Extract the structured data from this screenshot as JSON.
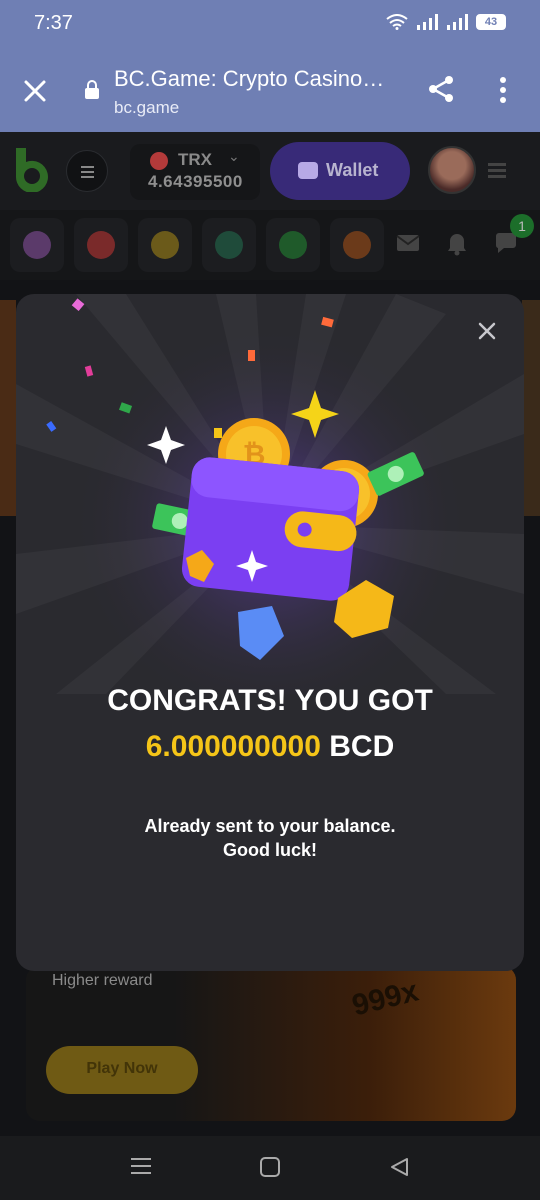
{
  "status_bar": {
    "time": "7:37",
    "battery": "43"
  },
  "browser": {
    "title": "BC.Game: Crypto Casino…",
    "url": "bc.game"
  },
  "site_header": {
    "currency": "TRX",
    "balance": "4.64395500",
    "wallet_label": "Wallet"
  },
  "icon_row": {
    "notification_count": "1"
  },
  "background": {
    "promo_text": "Higher reward",
    "play_label": "Play Now",
    "multiplier": "999x"
  },
  "modal": {
    "headline": "CONGRATS! YOU GOT",
    "amount": "6.000000000",
    "unit": "BCD",
    "message_line1": "Already sent to your balance.",
    "message_line2": "Good luck!"
  },
  "colors": {
    "accent_gold": "#f5c518",
    "wallet_purple": "#7b3ff2",
    "browser_bar": "#6f7fb4"
  }
}
